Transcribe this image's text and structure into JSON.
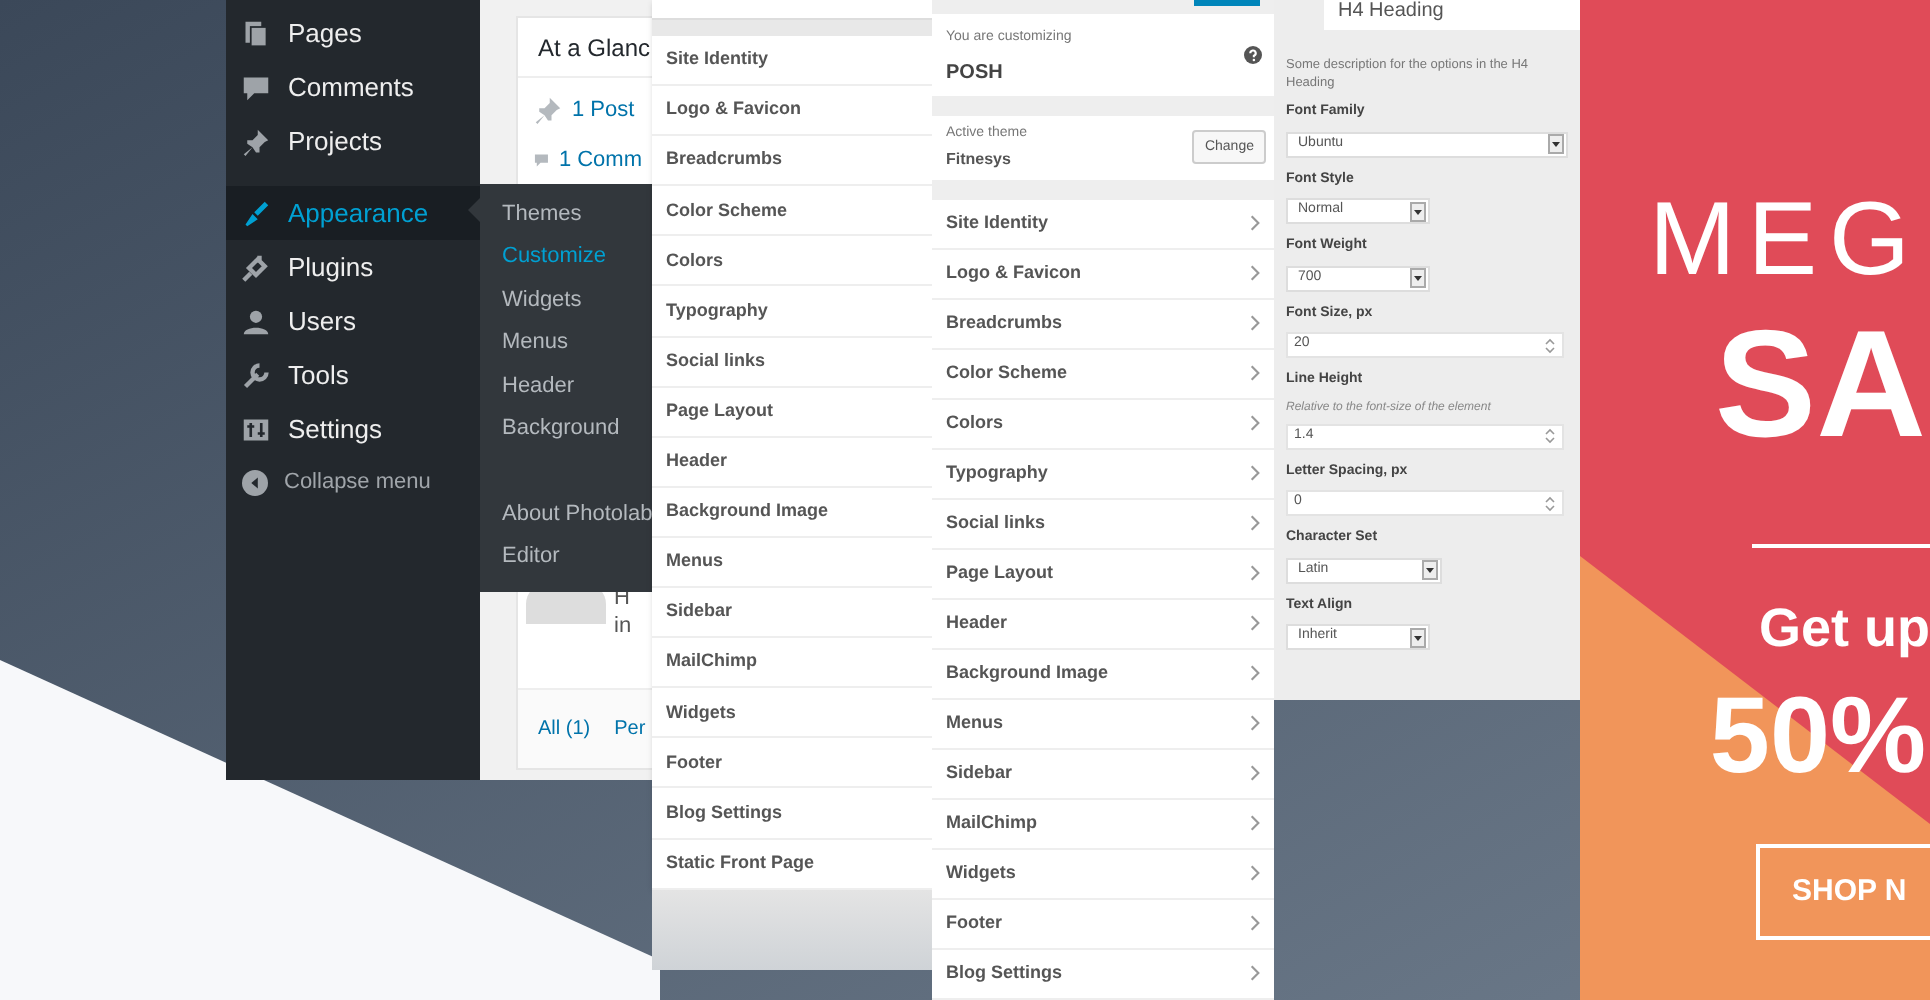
{
  "admin_menu": {
    "items": [
      {
        "label": "Pages",
        "kind": "pages",
        "selected": false
      },
      {
        "label": "Comments",
        "kind": "comments",
        "selected": false
      },
      {
        "label": "Projects",
        "kind": "pin",
        "selected": false
      },
      {
        "label": "Appearance",
        "kind": "brush",
        "selected": true
      },
      {
        "label": "Plugins",
        "kind": "plug",
        "selected": false
      },
      {
        "label": "Users",
        "kind": "user",
        "selected": false
      },
      {
        "label": "Tools",
        "kind": "wrench",
        "selected": false
      },
      {
        "label": "Settings",
        "kind": "settings",
        "selected": false
      }
    ],
    "collapse": "Collapse menu",
    "submenu": [
      {
        "label": "Themes",
        "selected": false
      },
      {
        "label": "Customize",
        "selected": true
      },
      {
        "label": "Widgets",
        "selected": false
      },
      {
        "label": "Menus",
        "selected": false
      },
      {
        "label": "Header",
        "selected": false
      },
      {
        "label": "Background",
        "selected": false
      },
      {
        "label": "About Photolab",
        "selected": false
      },
      {
        "label": "Editor",
        "selected": false
      }
    ]
  },
  "dashboard": {
    "glance_title": "At a Glanc",
    "glance_items": [
      {
        "kind": "pin",
        "label": "1 Post"
      },
      {
        "kind": "comments",
        "label": "1 Comm"
      }
    ],
    "activity_texts": [
      "H",
      "in"
    ],
    "footer_links": [
      "All (1)",
      "Per"
    ]
  },
  "customizer_back": {
    "items": [
      "Site Identity",
      "Logo & Favicon",
      "Breadcrumbs",
      "Color Scheme",
      "Colors",
      "Typography",
      "Social links",
      "Page Layout",
      "Header",
      "Background Image",
      "Menus",
      "Sidebar",
      "MailChimp",
      "Widgets",
      "Footer",
      "Blog Settings",
      "Static Front Page"
    ]
  },
  "customizer": {
    "customizing_label": "You are customizing",
    "site_name": "POSH",
    "active_theme_label": "Active theme",
    "active_theme": "Fitnesys",
    "change_button": "Change",
    "items": [
      "Site Identity",
      "Logo & Favicon",
      "Breadcrumbs",
      "Color Scheme",
      "Colors",
      "Typography",
      "Social links",
      "Page Layout",
      "Header",
      "Background Image",
      "Menus",
      "Sidebar",
      "MailChimp",
      "Widgets",
      "Footer",
      "Blog Settings"
    ]
  },
  "typography_panel": {
    "title": "H4 Heading",
    "description": "Some description for the options in the H4 Heading",
    "fields": [
      {
        "kind": "select",
        "label": "Font Family",
        "value": "Ubuntu"
      },
      {
        "kind": "select",
        "label": "Font Style",
        "value": "Normal"
      },
      {
        "kind": "select",
        "label": "Font Weight",
        "value": "700"
      },
      {
        "kind": "number",
        "label": "Font Size, px",
        "value": "20"
      },
      {
        "kind": "number",
        "label": "Line Height",
        "note": "Relative to the font-size of the element",
        "value": "1.4"
      },
      {
        "kind": "number",
        "label": "Letter Spacing, px",
        "value": "0"
      },
      {
        "kind": "select",
        "label": "Character Set",
        "value": "Latin"
      },
      {
        "kind": "select",
        "label": "Text Align",
        "value": "Inherit"
      }
    ]
  },
  "banner": {
    "line_1": "MEG",
    "line_2": "SA",
    "line_3": "Get up",
    "line_4": "50%",
    "button": "SHOP N"
  }
}
